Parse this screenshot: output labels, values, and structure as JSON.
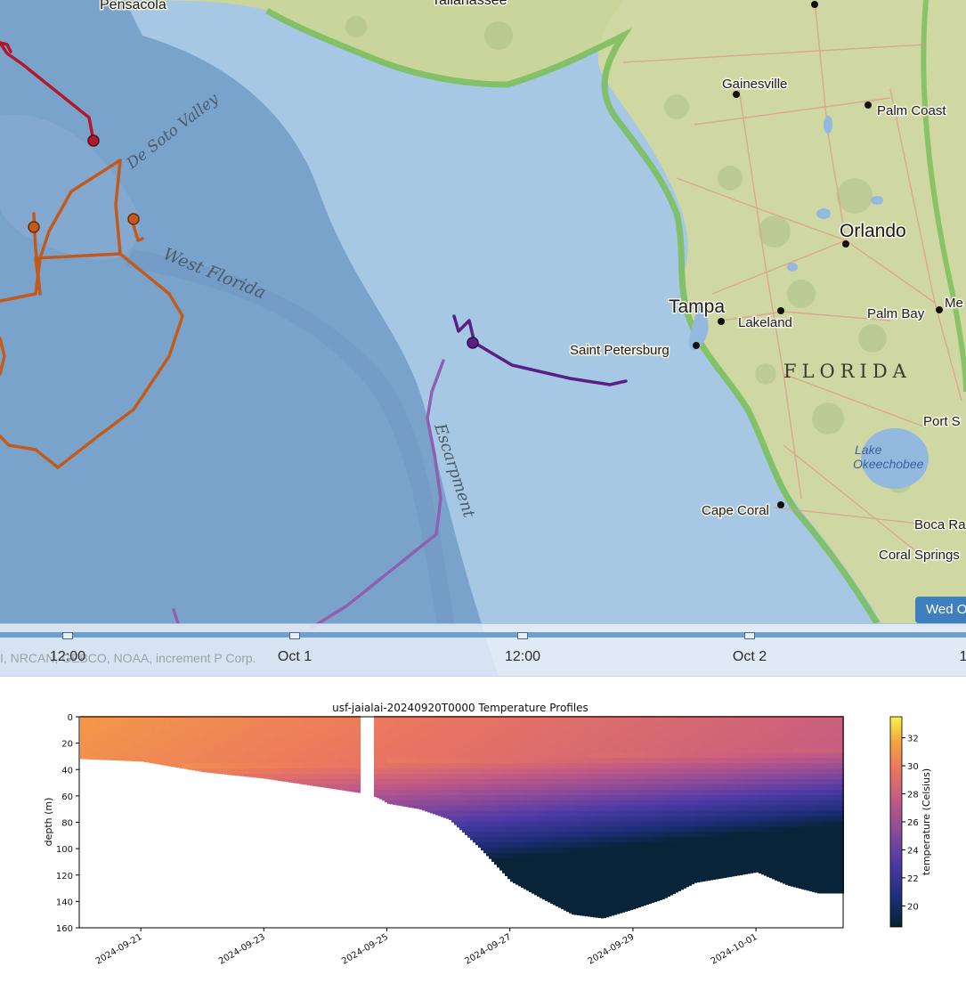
{
  "map": {
    "cities": [
      {
        "name": "Pensacola"
      },
      {
        "name": "Tallahassee"
      },
      {
        "name": "Gainesville"
      },
      {
        "name": "Palm Coast"
      },
      {
        "name": "Orlando"
      },
      {
        "name": "Tampa"
      },
      {
        "name": "Lakeland"
      },
      {
        "name": "Palm Bay"
      },
      {
        "name": "Saint Petersburg"
      },
      {
        "name": "Cape Coral"
      },
      {
        "name": "Port S"
      },
      {
        "name": "Boca Ra"
      },
      {
        "name": "Coral Springs"
      },
      {
        "name": "Me"
      }
    ],
    "features": {
      "de_soto": "De Soto Valley",
      "west_florida": "West Florida",
      "escarpment": "Escarpment",
      "state": "FLORIDA",
      "lake_line1": "Lake",
      "lake_line2": "Okeechobee"
    },
    "date_badge": "Wed O",
    "attribution": "I, NRCAN, GEBCO, NOAA, increment P Corp.",
    "timeline_ticks": [
      "12:00",
      "Oct 1",
      "12:00",
      "Oct 2",
      "1"
    ],
    "colors": {
      "track_red": "#b0182b",
      "track_orange": "#c25a1c",
      "track_purple_dark": "#5a1f82",
      "track_purple_light": "#9060b0"
    }
  },
  "chart_data": {
    "type": "scatter",
    "title": "usf-jaialai-20240920T0000 Temperature Profiles",
    "xlabel": "",
    "ylabel": "depth (m)",
    "colorbar_label": "temperature (Celsius)",
    "x_ticks": [
      "2024-09-21",
      "2024-09-23",
      "2024-09-25",
      "2024-09-27",
      "2024-09-29",
      "2024-10-01"
    ],
    "y_ticks": [
      0,
      20,
      40,
      60,
      80,
      100,
      120,
      140,
      160
    ],
    "ylim": [
      160,
      0
    ],
    "colorbar_ticks": [
      20,
      22,
      24,
      26,
      28,
      30,
      32
    ],
    "colorbar_range": [
      18.5,
      33.5
    ],
    "colormap": "thermal",
    "grid": false,
    "max_depth_profile": [
      {
        "date": "2024-09-20",
        "depth": 32
      },
      {
        "date": "2024-09-21",
        "depth": 34
      },
      {
        "date": "2024-09-22",
        "depth": 42
      },
      {
        "date": "2024-09-23",
        "depth": 47
      },
      {
        "date": "2024-09-24",
        "depth": 54
      },
      {
        "date": "2024-09-24.7",
        "depth": 59
      },
      {
        "date": "2024-09-24.9",
        "depth": 63
      },
      {
        "date": "2024-09-25",
        "depth": 66
      },
      {
        "date": "2024-09-25.5",
        "depth": 70
      },
      {
        "date": "2024-09-26",
        "depth": 78
      },
      {
        "date": "2024-09-26.5",
        "depth": 100
      },
      {
        "date": "2024-09-27",
        "depth": 125
      },
      {
        "date": "2024-09-27.5",
        "depth": 138
      },
      {
        "date": "2024-09-28",
        "depth": 150
      },
      {
        "date": "2024-09-28.5",
        "depth": 153
      },
      {
        "date": "2024-09-29",
        "depth": 146
      },
      {
        "date": "2024-09-29.5",
        "depth": 138
      },
      {
        "date": "2024-09-30",
        "depth": 126
      },
      {
        "date": "2024-09-30.5",
        "depth": 122
      },
      {
        "date": "2024-10-01",
        "depth": 118
      },
      {
        "date": "2024-10-01.5",
        "depth": 128
      },
      {
        "date": "2024-10-02",
        "depth": 134
      }
    ]
  }
}
